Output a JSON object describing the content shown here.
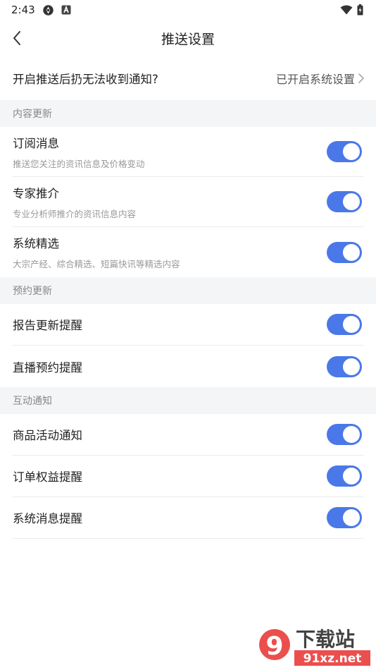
{
  "status_bar": {
    "time": "2:43",
    "icons": [
      "location-icon",
      "a-badge-icon",
      "wifi-icon",
      "battery-icon"
    ]
  },
  "nav": {
    "title": "推送设置",
    "back_icon": "chevron-left-icon"
  },
  "banner": {
    "question": "开启推送后扔无法收到通知?",
    "link": "已开启系统设置",
    "chevron": "chevron-right-icon"
  },
  "sections": [
    {
      "header": "内容更新",
      "items": [
        {
          "title": "订阅消息",
          "subtitle": "推送您关注的资讯信息及价格变动",
          "enabled": true
        },
        {
          "title": "专家推介",
          "subtitle": "专业分析师推介的资讯信息内容",
          "enabled": true
        },
        {
          "title": "系统精选",
          "subtitle": "大宗产经、综合精选、短篇快讯等精选内容",
          "enabled": true
        }
      ]
    },
    {
      "header": "预约更新",
      "items": [
        {
          "title": "报告更新提醒",
          "enabled": true
        },
        {
          "title": "直播预约提醒",
          "enabled": true
        }
      ]
    },
    {
      "header": "互动通知",
      "items": [
        {
          "title": "商品活动通知",
          "enabled": true
        },
        {
          "title": "订单权益提醒",
          "enabled": true
        },
        {
          "title": "系统消息提醒",
          "enabled": true
        }
      ]
    }
  ],
  "watermark": {
    "text_cn": "下载站",
    "text_url": "91xz.net",
    "logo_text": "9",
    "colors": {
      "red": "#e8312f",
      "blue": "#2b6cd8"
    }
  },
  "colors": {
    "toggle_on": "#4a78e8",
    "section_bg": "#f4f5f7"
  }
}
